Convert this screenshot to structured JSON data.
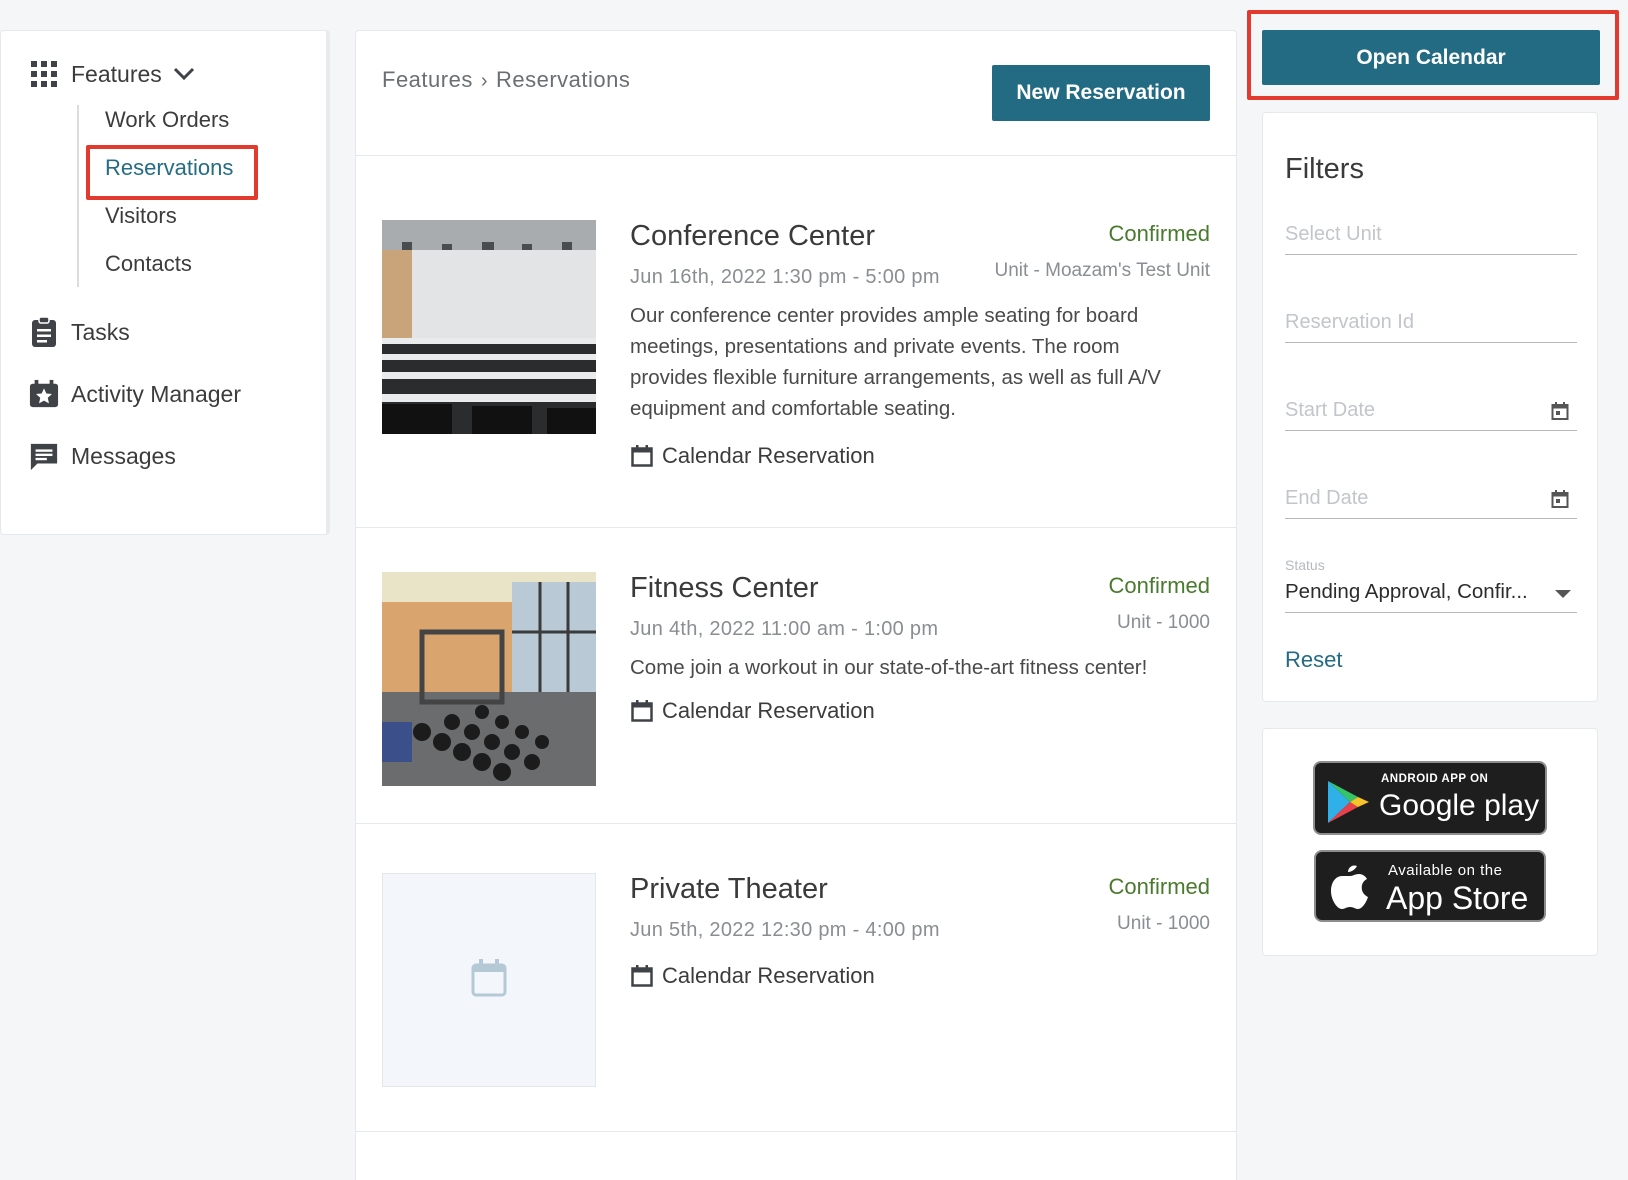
{
  "sidebar": {
    "features_label": "Features",
    "sub_items": [
      "Work Orders",
      "Reservations",
      "Visitors",
      "Contacts"
    ],
    "items": [
      "Tasks",
      "Activity Manager",
      "Messages"
    ]
  },
  "main": {
    "breadcrumb": {
      "parent": "Features",
      "separator": "›",
      "current": "Reservations"
    },
    "new_reservation_label": "New Reservation",
    "reservations": [
      {
        "title": "Conference Center",
        "status": "Confirmed",
        "date": "Jun 16th, 2022  1:30 pm - 5:00 pm",
        "unit": "Unit - Moazam's Test Unit",
        "description": "Our conference center provides ample seating for board meetings, presentations and private events. The room provides flexible furniture arrangements, as well as full A/V equipment and comfortable seating.",
        "type": "Calendar Reservation"
      },
      {
        "title": "Fitness Center",
        "status": "Confirmed",
        "date": "Jun 4th, 2022  11:00 am - 1:00 pm",
        "unit": "Unit - 1000",
        "description": "Come join a workout in our state-of-the-art fitness center!",
        "type": "Calendar Reservation"
      },
      {
        "title": "Private Theater",
        "status": "Confirmed",
        "date": "Jun 5th, 2022  12:30 pm - 4:00 pm",
        "unit": "Unit - 1000",
        "type": "Calendar Reservation"
      }
    ]
  },
  "right": {
    "open_calendar_label": "Open Calendar",
    "filters": {
      "title": "Filters",
      "unit_placeholder": "Select Unit",
      "reservation_id_placeholder": "Reservation Id",
      "start_date_placeholder": "Start Date",
      "end_date_placeholder": "End Date",
      "status_label": "Status",
      "status_value": "Pending Approval, Confir...",
      "reset_label": "Reset"
    },
    "apps": {
      "google_small": "ANDROID APP ON",
      "google_big": "Google play",
      "apple_small": "Available on the",
      "apple_big": "App Store"
    }
  },
  "colors": {
    "primary": "#236b83",
    "confirmed": "#4a7a2e",
    "highlight": "#e33a2f"
  }
}
